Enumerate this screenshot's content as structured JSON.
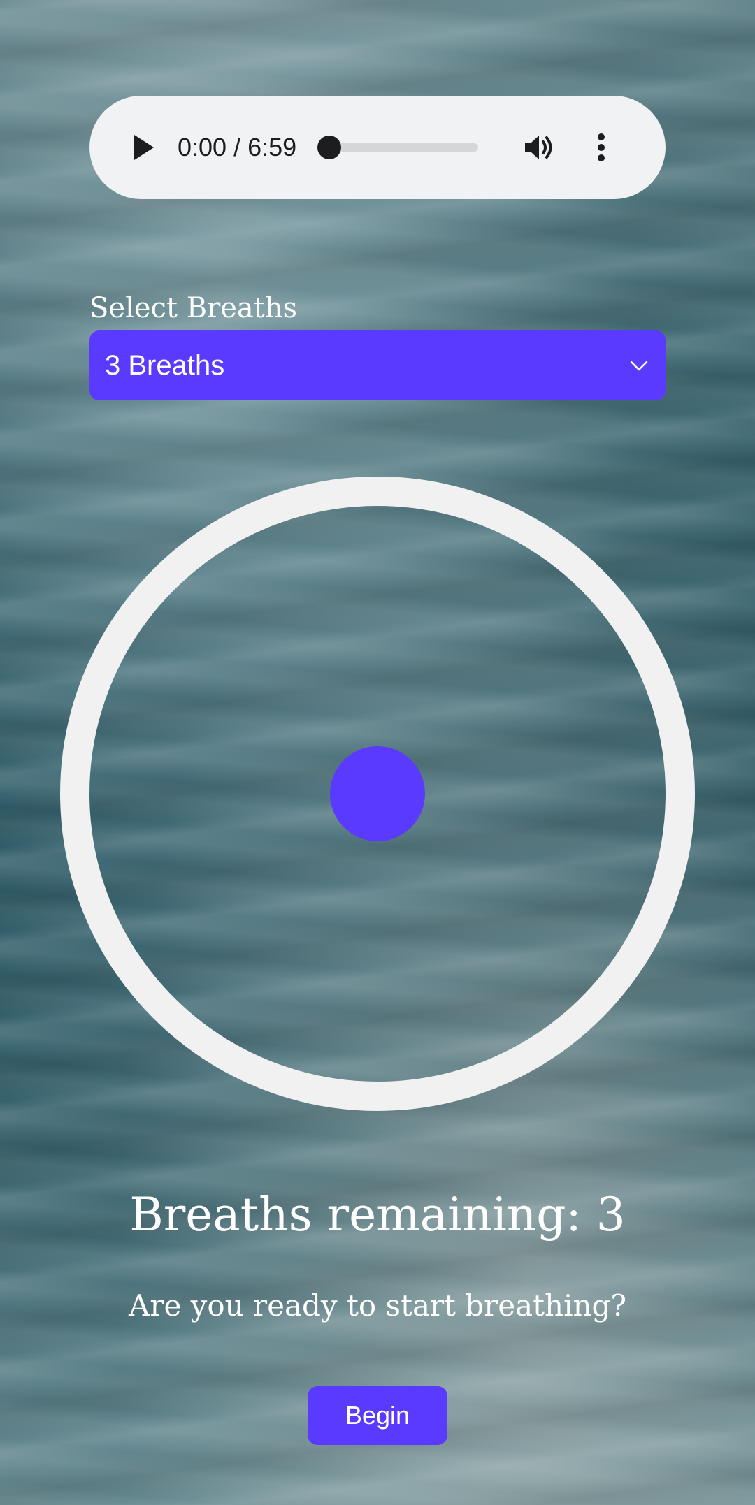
{
  "audio": {
    "time": "0:00 / 6:59",
    "progress": 0.0,
    "play_icon": "play-icon",
    "volume_icon": "volume-icon",
    "menu_icon": "more-vertical-icon"
  },
  "breaths_select": {
    "label": "Select Breaths",
    "value": "3 Breaths",
    "icon": "chevron-down-icon"
  },
  "status": {
    "remaining_text": "Breaths remaining: 3",
    "prompt": "Are you ready to start breathing?"
  },
  "actions": {
    "begin_label": "Begin"
  },
  "colors": {
    "accent": "#5b3aff",
    "surface": "#f1f2f3",
    "text_light": "#ffffff"
  }
}
